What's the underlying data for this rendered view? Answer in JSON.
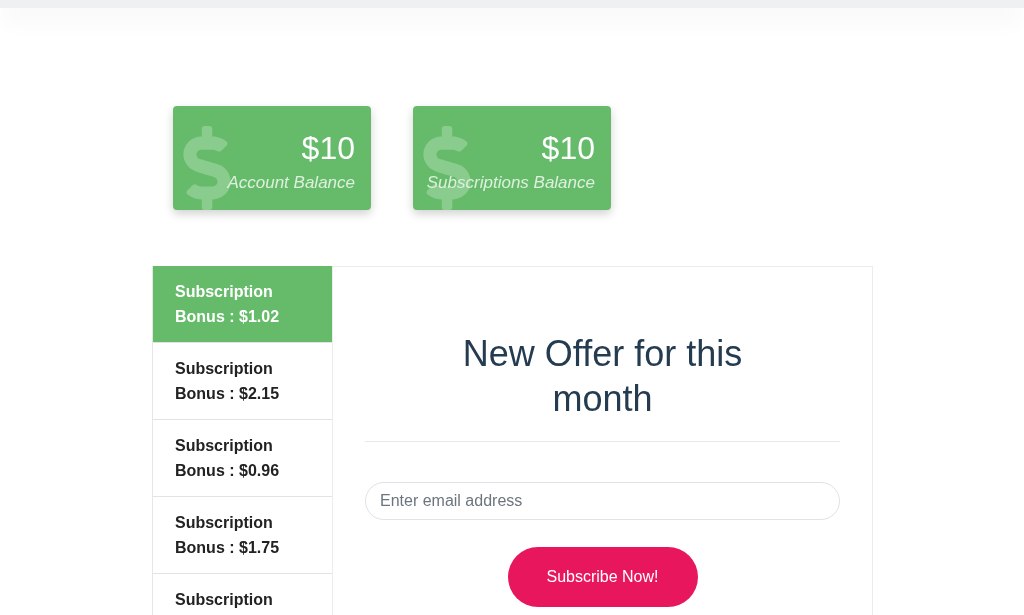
{
  "balance_cards": [
    {
      "amount": "$10",
      "label": "Account Balance"
    },
    {
      "amount": "$10",
      "label": "Subscriptions Balance"
    }
  ],
  "bonus_tabs": [
    {
      "label": "Subscription Bonus : $1.02",
      "selected": true
    },
    {
      "label": "Subscription Bonus : $2.15",
      "selected": false
    },
    {
      "label": "Subscription Bonus : $0.96",
      "selected": false
    },
    {
      "label": "Subscription Bonus : $1.75",
      "selected": false
    },
    {
      "label": "Subscription",
      "selected": false
    }
  ],
  "offer": {
    "title": "New Offer for this month",
    "email_field": {
      "placeholder": "Enter email address"
    },
    "button": "Subscribe Now!"
  }
}
